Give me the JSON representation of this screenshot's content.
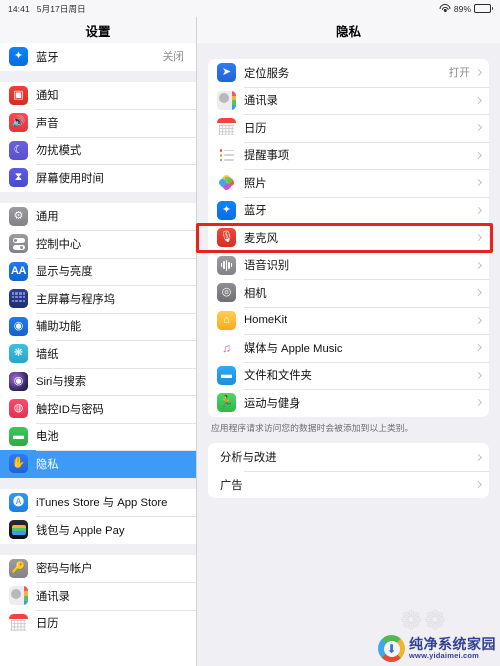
{
  "status_bar": {
    "time": "14:41",
    "date": "5月17日周日",
    "battery_percent": "89%",
    "wifi_icon": "wifi-icon",
    "battery_icon": "battery-icon",
    "battery_level": 89
  },
  "sidebar": {
    "title": "设置",
    "groups": [
      {
        "items": [
          {
            "label": "蓝牙",
            "value": "关闭",
            "icon": "bluetooth-icon",
            "icon_class": "ic-bluetooth",
            "glyph": "✦",
            "selected": false
          }
        ]
      },
      {
        "items": [
          {
            "label": "通知",
            "value": "",
            "icon": "notifications-icon",
            "icon_class": "ic-notify",
            "glyph": "▣",
            "selected": false
          },
          {
            "label": "声音",
            "value": "",
            "icon": "sound-icon",
            "icon_class": "ic-sound",
            "glyph": "🔊",
            "selected": false
          },
          {
            "label": "勿扰模式",
            "value": "",
            "icon": "do-not-disturb-icon",
            "icon_class": "ic-dnd",
            "glyph": "☾",
            "selected": false
          },
          {
            "label": "屏幕使用时间",
            "value": "",
            "icon": "screen-time-icon",
            "icon_class": "ic-screentime",
            "glyph": "⧗",
            "selected": false
          }
        ]
      },
      {
        "items": [
          {
            "label": "通用",
            "value": "",
            "icon": "gear-icon",
            "icon_class": "ic-general",
            "glyph": "⚙",
            "selected": false
          },
          {
            "label": "控制中心",
            "value": "",
            "icon": "control-center-icon",
            "icon_class": "ic-control",
            "glyph": "",
            "selected": false
          },
          {
            "label": "显示与亮度",
            "value": "",
            "icon": "display-brightness-icon",
            "icon_class": "ic-display",
            "glyph": "AA",
            "selected": false
          },
          {
            "label": "主屏幕与程序坞",
            "value": "",
            "icon": "home-screen-dock-icon",
            "icon_class": "ic-home",
            "glyph": "",
            "selected": false
          },
          {
            "label": "辅助功能",
            "value": "",
            "icon": "accessibility-icon",
            "icon_class": "ic-access",
            "glyph": "◉",
            "selected": false
          },
          {
            "label": "墙纸",
            "value": "",
            "icon": "wallpaper-icon",
            "icon_class": "ic-wallpaper",
            "glyph": "❋",
            "selected": false
          },
          {
            "label": "Siri与搜索",
            "value": "",
            "icon": "siri-icon",
            "icon_class": "ic-siri",
            "glyph": "◉",
            "selected": false
          },
          {
            "label": "触控ID与密码",
            "value": "",
            "icon": "touch-id-icon",
            "icon_class": "ic-touchid",
            "glyph": "◍",
            "selected": false
          },
          {
            "label": "电池",
            "value": "",
            "icon": "battery-icon",
            "icon_class": "ic-battery",
            "glyph": "▬",
            "selected": false
          },
          {
            "label": "隐私",
            "value": "",
            "icon": "privacy-hand-icon",
            "icon_class": "ic-privacy",
            "glyph": "✋",
            "selected": true
          }
        ]
      },
      {
        "items": [
          {
            "label": "iTunes Store 与 App Store",
            "value": "",
            "icon": "app-store-icon",
            "icon_class": "ic-itunes",
            "glyph": "🅐",
            "selected": false
          },
          {
            "label": "钱包与 Apple Pay",
            "value": "",
            "icon": "wallet-icon",
            "icon_class": "ic-wallet",
            "glyph": "",
            "selected": false
          }
        ]
      },
      {
        "items": [
          {
            "label": "密码与帐户",
            "value": "",
            "icon": "passwords-key-icon",
            "icon_class": "ic-passwords",
            "glyph": "🔑",
            "selected": false
          },
          {
            "label": "通讯录",
            "value": "",
            "icon": "contacts-icon",
            "icon_class": "ic-contacts",
            "glyph": "",
            "selected": false
          },
          {
            "label": "日历",
            "value": "",
            "icon": "calendar-icon",
            "icon_class": "ic-calendar",
            "glyph": "",
            "selected": false
          }
        ]
      }
    ]
  },
  "content": {
    "title": "隐私",
    "list": [
      {
        "label": "定位服务",
        "value": "打开",
        "icon": "location-services-icon",
        "icon_class": "ic-location",
        "glyph": "➤",
        "highlighted": false
      },
      {
        "label": "通讯录",
        "value": "",
        "icon": "contacts-icon",
        "icon_class": "ic-contacts",
        "glyph": "",
        "highlighted": false
      },
      {
        "label": "日历",
        "value": "",
        "icon": "calendar-icon",
        "icon_class": "ic-calendar",
        "glyph": "",
        "highlighted": false
      },
      {
        "label": "提醒事项",
        "value": "",
        "icon": "reminders-icon",
        "icon_class": "ic-reminders",
        "glyph": "",
        "highlighted": false
      },
      {
        "label": "照片",
        "value": "",
        "icon": "photos-icon",
        "icon_class": "ic-photos",
        "glyph": "",
        "highlighted": false
      },
      {
        "label": "蓝牙",
        "value": "",
        "icon": "bluetooth-icon",
        "icon_class": "ic-bluetooth",
        "glyph": "✦",
        "highlighted": false
      },
      {
        "label": "麦克风",
        "value": "",
        "icon": "microphone-icon",
        "icon_class": "ic-mic",
        "glyph": "🎙",
        "highlighted": true
      },
      {
        "label": "语音识别",
        "value": "",
        "icon": "speech-recognition-icon",
        "icon_class": "ic-speech",
        "glyph": "",
        "highlighted": false
      },
      {
        "label": "相机",
        "value": "",
        "icon": "camera-icon",
        "icon_class": "ic-camera",
        "glyph": "◎",
        "highlighted": false
      },
      {
        "label": "HomeKit",
        "value": "",
        "icon": "homekit-icon",
        "icon_class": "ic-homekit",
        "glyph": "⌂",
        "highlighted": false
      },
      {
        "label": "媒体与 Apple Music",
        "value": "",
        "icon": "music-icon",
        "icon_class": "ic-music",
        "glyph": "♫",
        "highlighted": false
      },
      {
        "label": "文件和文件夹",
        "value": "",
        "icon": "files-icon",
        "icon_class": "ic-files",
        "glyph": "▬",
        "highlighted": false
      },
      {
        "label": "运动与健身",
        "value": "",
        "icon": "fitness-icon",
        "icon_class": "ic-fitness",
        "glyph": "🏃",
        "highlighted": false
      }
    ],
    "footer_note": "应用程序请求访问您的数据时会被添加到以上类别。",
    "bottom_list": [
      {
        "label": "分析与改进"
      },
      {
        "label": "广告"
      }
    ]
  },
  "annotation": {
    "type": "red-rectangle",
    "color": "#e8231f",
    "target_label": "麦克风"
  },
  "watermark": {
    "name": "纯净系统家园",
    "url": "www.yidaimei.com"
  }
}
